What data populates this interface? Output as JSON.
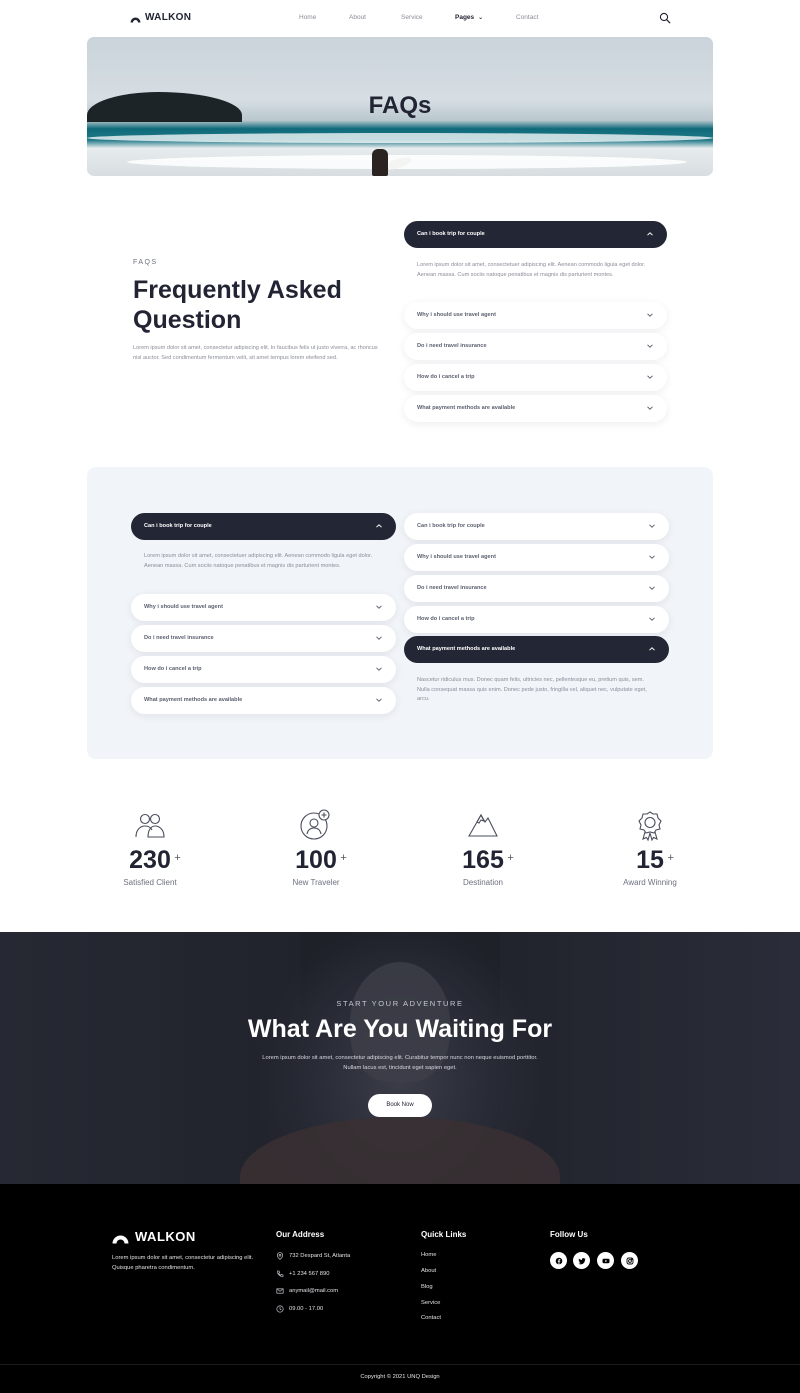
{
  "brand": {
    "name": "WALKON"
  },
  "nav": {
    "items": [
      {
        "label": "Home"
      },
      {
        "label": "About"
      },
      {
        "label": "Service"
      },
      {
        "label": "Pages"
      },
      {
        "label": "Contact"
      }
    ],
    "active": "Pages",
    "search_icon": "search-icon"
  },
  "hero": {
    "title": "FAQs"
  },
  "faq_section": {
    "eyebrow": "FAQS",
    "title": "Frequently Asked Question",
    "description": "Lorem ipsum dolor sit amet, consectetur adipiscing elit. In faucibus felis ut justo viverra, ac rhoncus nisl auctor. Sed condimentum fermentum velit, sit amet tempus lorem eleifend sed.",
    "accordion": [
      {
        "question": "Can i book trip for couple",
        "open": true,
        "answer": "Lorem ipsum dolor sit amet, consectetuer adipiscing elit. Aenean commodo ligula eget dolor. Aenean massa. Cum sociis natoque penatibus et magnis dis parturient montes."
      },
      {
        "question": "Why i should use travel agent",
        "open": false
      },
      {
        "question": "Do i need travel insurance",
        "open": false
      },
      {
        "question": "How do i cancel a trip",
        "open": false
      },
      {
        "question": "What payment methods are available",
        "open": false
      }
    ]
  },
  "faq_panel": {
    "left": [
      {
        "question": "Can i book trip for couple",
        "open": true,
        "answer": "Lorem ipsum dolor sit amet, consectetuer adipiscing elit. Aenean commodo ligula eget dolor. Aenean massa. Cum sociis natoque penatibus et magnis dis parturient montes."
      },
      {
        "question": "Why i should use travel agent",
        "open": false
      },
      {
        "question": "Do i need travel insurance",
        "open": false
      },
      {
        "question": "How do i cancel a trip",
        "open": false
      },
      {
        "question": "What payment methods are available",
        "open": false
      }
    ],
    "right": [
      {
        "question": "Can i book trip for couple",
        "open": false
      },
      {
        "question": "Why i should use travel agent",
        "open": false
      },
      {
        "question": "Do i need travel insurance",
        "open": false
      },
      {
        "question": "How do i cancel a trip",
        "open": false
      },
      {
        "question": "What payment methods are available",
        "open": true,
        "answer": "Nascetur ridiculus mus. Donec quam felis, ultricies nec, pellentesque eu, pretium quis, sem. Nulla consequat massa quis enim. Donec pede justo, fringilla vel, aliquet nec, vulputate eget, arcu."
      }
    ]
  },
  "stats": [
    {
      "value": "230",
      "suffix": "+",
      "label": "Satisfied Client",
      "icon": "clients-icon"
    },
    {
      "value": "100",
      "suffix": "+",
      "label": "New Traveler",
      "icon": "traveler-icon"
    },
    {
      "value": "165",
      "suffix": "+",
      "label": "Destination",
      "icon": "mountain-icon"
    },
    {
      "value": "15",
      "suffix": "+",
      "label": "Award Winning",
      "icon": "award-icon"
    }
  ],
  "cta": {
    "eyebrow": "START YOUR ADVENTURE",
    "title": "What Are You Waiting For",
    "description": "Lorem ipsum dolor sit amet, consectetur adipiscing elit. Curabitur tempor nunc non neque euismod porttitor. Nullam lacus est, tincidunt eget sapien eget.",
    "button": "Book Now"
  },
  "footer": {
    "brand": "WALKON",
    "about": "Lorem ipsum dolor sit amet, consectetur adipiscing elit. Quisque pharetra condimentum.",
    "address_heading": "Our Address",
    "address": [
      {
        "icon": "location-icon",
        "text": "732 Despard St, Atlanta"
      },
      {
        "icon": "phone-icon",
        "text": "+1 234 567 890"
      },
      {
        "icon": "mail-icon",
        "text": "anymail@mail.com"
      },
      {
        "icon": "clock-icon",
        "text": "09.00 - 17.00"
      }
    ],
    "links_heading": "Quick Links",
    "links": [
      "Home",
      "About",
      "Blog",
      "Service",
      "Contact"
    ],
    "follow_heading": "Follow Us",
    "social": [
      "facebook-icon",
      "twitter-icon",
      "youtube-icon",
      "instagram-icon"
    ],
    "copyright": "Copyright © 2021 UNQ Design"
  },
  "colors": {
    "dark": "#232634",
    "panel_bg": "#f1f4f8",
    "muted_text": "#8a8d99",
    "footer_bg": "#000000"
  }
}
